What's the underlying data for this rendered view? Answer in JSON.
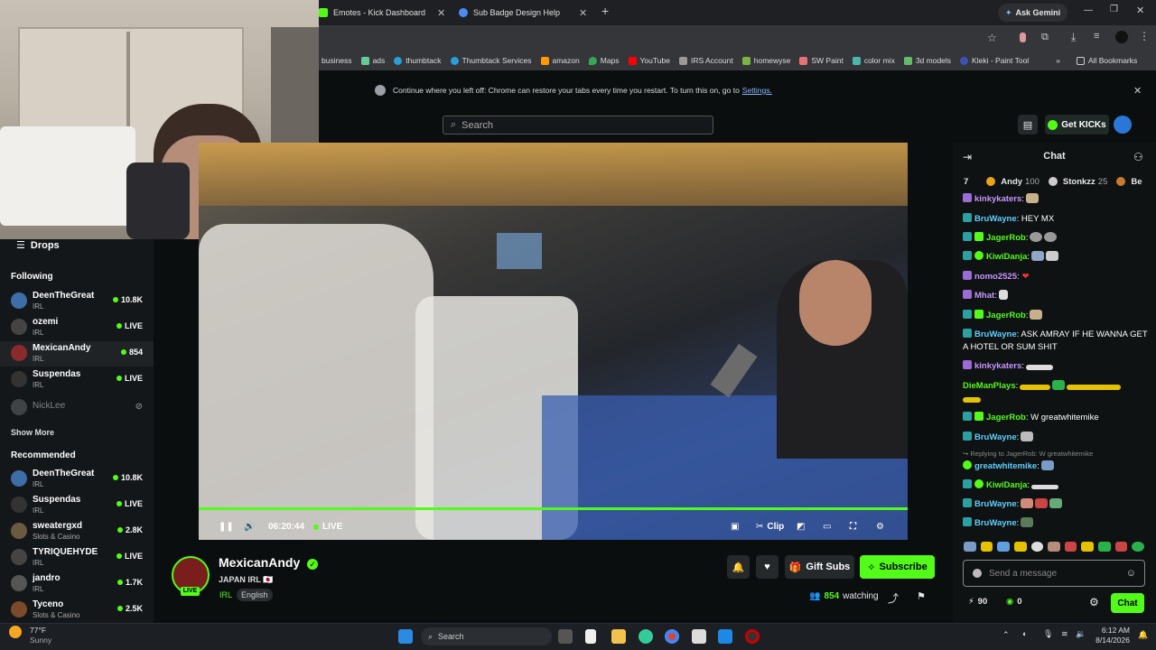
{
  "browser": {
    "tabs": [
      {
        "title": "Emotes - Kick Dashboard"
      },
      {
        "title": "Sub Badge Design Help"
      }
    ],
    "new_tab": "+",
    "gemini": "Ask Gemini",
    "bookmarks": [
      "business",
      "ads",
      "thumbtack",
      "Thumbtack Services",
      "amazon",
      "Maps",
      "YouTube",
      "IRS Account",
      "homewyse",
      "SW Paint",
      "color mix",
      "3d models",
      "Kleki - Paint Tool"
    ],
    "bookmarks_more": "»",
    "all_bookmarks": "All Bookmarks",
    "restore_text": "Continue where you left off: Chrome can restore your tabs every time you restart. To turn this on, go to",
    "restore_link": "Settings."
  },
  "kick": {
    "search_placeholder": "Search",
    "get_kicks": "Get KICKs"
  },
  "sidebar": {
    "drops": "Drops",
    "following_title": "Following",
    "following": [
      {
        "name": "DeenTheGreat",
        "category": "IRL",
        "viewers": "10.8K"
      },
      {
        "name": "ozemi",
        "category": "IRL",
        "viewers": "LIVE"
      },
      {
        "name": "MexicanAndy",
        "category": "IRL",
        "viewers": "854"
      },
      {
        "name": "Suspendas",
        "category": "IRL",
        "viewers": "LIVE"
      },
      {
        "name": "NickLee",
        "category": "",
        "viewers": ""
      }
    ],
    "show_more": "Show More",
    "recommended_title": "Recommended",
    "recommended": [
      {
        "name": "DeenTheGreat",
        "category": "IRL",
        "viewers": "10.8K"
      },
      {
        "name": "Suspendas",
        "category": "IRL",
        "viewers": "LIVE"
      },
      {
        "name": "sweatergxd",
        "category": "Slots & Casino",
        "viewers": "2.8K"
      },
      {
        "name": "TYRIQUEHYDE",
        "category": "IRL",
        "viewers": "LIVE"
      },
      {
        "name": "jandro",
        "category": "IRL",
        "viewers": "1.7K"
      },
      {
        "name": "Tyceno",
        "category": "Slots & Casino",
        "viewers": "2.5K"
      }
    ]
  },
  "player": {
    "time": "06:20:44",
    "live": "LIVE",
    "clip": "Clip"
  },
  "channel": {
    "live_badge": "LIVE",
    "name": "MexicanAndy",
    "title": "JAPAN IRL 🇯🇵",
    "tags": [
      "IRL",
      "English"
    ],
    "gift_subs": "Gift Subs",
    "subscribe": "Subscribe",
    "watching_count": "854",
    "watching_label": "watching"
  },
  "chat": {
    "title": "Chat",
    "leaderboard": [
      {
        "rank": "7",
        "name": "",
        "score": ""
      },
      {
        "rank": "",
        "name": "Andy",
        "score": "100"
      },
      {
        "rank": "",
        "name": "Stonkzz",
        "score": "25"
      },
      {
        "rank": "",
        "name": "Be",
        "score": ""
      }
    ],
    "messages": [
      {
        "user": "kinkykaters",
        "text": ":"
      },
      {
        "user": "BruWayne",
        "text": ": HEY MX"
      },
      {
        "user": "JagerRob",
        "text": ":"
      },
      {
        "user": "KiwiDanja",
        "text": ":"
      },
      {
        "user": "nomo2525",
        "text": ":"
      },
      {
        "user": "Mhat",
        "text": ":"
      },
      {
        "user": "JagerRob",
        "text": ":"
      },
      {
        "user": "BruWayne",
        "text": ": ASK AMRAY IF HE WANNA GET A HOTEL OR SUM SHIT"
      },
      {
        "user": "kinkykaters",
        "text": ":"
      },
      {
        "user": "DieManPlays",
        "text": ":"
      },
      {
        "user": "JagerRob",
        "text": ": W greatwhitemike"
      },
      {
        "user": "BruWayne",
        "text": ":"
      },
      {
        "user": "greatwhitemike",
        "text": ":"
      },
      {
        "user": "KiwiDanja",
        "text": ":"
      },
      {
        "user": "BruWayne",
        "text": ":"
      },
      {
        "user": "BruWayne",
        "text": ":"
      }
    ],
    "reply_hint": "Replying to JagerRob: W greatwhitemike",
    "input_placeholder": "Send a message",
    "points": "90",
    "kicks": "0",
    "send": "Chat"
  },
  "taskbar": {
    "weather_temp": "77°F",
    "weather_desc": "Sunny",
    "search": "Search",
    "time": "6:12 AM",
    "date": "8/14/2026"
  },
  "colors": {
    "kick_green": "#53fc18",
    "bg": "#0b0e0f"
  }
}
